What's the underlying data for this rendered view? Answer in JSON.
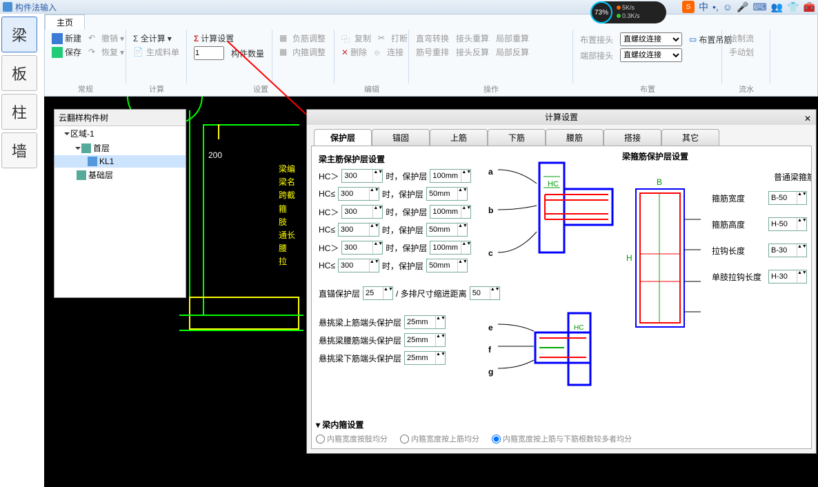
{
  "app": {
    "title": "构件法输入"
  },
  "perf": {
    "percent": "73%",
    "up": "5K/s",
    "down": "0.3K/s"
  },
  "ime": {
    "brand": "S",
    "lang": "中"
  },
  "left_rail": {
    "beam": "梁",
    "slab": "板",
    "column": "柱",
    "wall": "墙"
  },
  "ribbon": {
    "tab_home": "主页",
    "general": {
      "new": "新建",
      "save": "保存",
      "undo": "撤销",
      "redo": "恢复",
      "label": "常规"
    },
    "calc": {
      "all": "Σ 全计算",
      "bom": "生成料单",
      "num_val": "1",
      "num_lbl": "构件数量",
      "label": "计算"
    },
    "settings": {
      "calc_set": "计算设置",
      "neg_adj": "负筋调整",
      "inner_adj": "内箍调整",
      "label": "设置"
    },
    "edit": {
      "copy": "复制",
      "delete": "删除",
      "break": "打断",
      "link": "连接",
      "label": "编辑"
    },
    "ops": {
      "curve": "直弯转换",
      "renum": "筋号重排",
      "conn_recalc": "接头重算",
      "conn_back": "接头反算",
      "loc_recalc": "局部重算",
      "loc_back": "局部反算",
      "label": "操作"
    },
    "layout": {
      "place_conn": "布置接头",
      "end_conn": "端部接头",
      "sel1": "直螺纹连接",
      "sel2": "直螺纹连接",
      "hanger": "布置吊筋",
      "label": "布置"
    },
    "flow": {
      "draw": "绘制流",
      "manual": "手动划",
      "label": "流水"
    }
  },
  "tree": {
    "title": "云翻样构件树",
    "zone": "区域-1",
    "floor1": "首层",
    "kl1": "KL1",
    "base": "基础层"
  },
  "canvas": {
    "dim_200": "200",
    "labels": [
      "梁编",
      "梁名",
      "跨截",
      "箍",
      "肢",
      "通长",
      "腰",
      "拉"
    ]
  },
  "dlg": {
    "title": "计算设置",
    "tabs": {
      "cover": "保护层",
      "anchor": "锚固",
      "top": "上筋",
      "bot": "下筋",
      "waist": "腰筋",
      "lap": "搭接",
      "other": "其它"
    },
    "main_cover_title": "梁主筋保护层设置",
    "stirrup_cover_title": "梁箍筋保护层设置",
    "hc_gt": "HC＞",
    "hc_le": "HC≤",
    "cover_lbl": "时，保护层",
    "v300": "300",
    "v100": "100mm",
    "v50": "50mm",
    "pts": {
      "a": "a",
      "b": "b",
      "c": "c",
      "e": "e",
      "f": "f",
      "g": "g"
    },
    "straight_anchor": "直锚保护层",
    "v25": "25",
    "multi_row": "/ 多排尺寸缩进距离",
    "v50n": "50",
    "canti_top": "悬挑梁上筋端头保护层",
    "canti_waist": "悬挑梁腰筋端头保护层",
    "canti_bot": "悬挑梁下筋端头保护层",
    "v25mm": "25mm",
    "stirrup_col_hdr": "普通梁箍筋",
    "s_width": "箍筋宽度",
    "s_height": "箍筋高度",
    "hook_len": "拉钩长度",
    "single_hook": "单肢拉钩长度",
    "b50": "B-50",
    "h50": "H-50",
    "b30": "B-30",
    "h30": "H-30",
    "diag_b": "B",
    "diag_h": "H",
    "diag_hc": "HC",
    "inner_title": "梁内箍设置",
    "tri": "▾",
    "opt1": "内箍宽度按肢均分",
    "opt2": "内箍宽度按上筋均分",
    "opt3": "内箍宽度按上筋与下筋根数较多者均分"
  }
}
